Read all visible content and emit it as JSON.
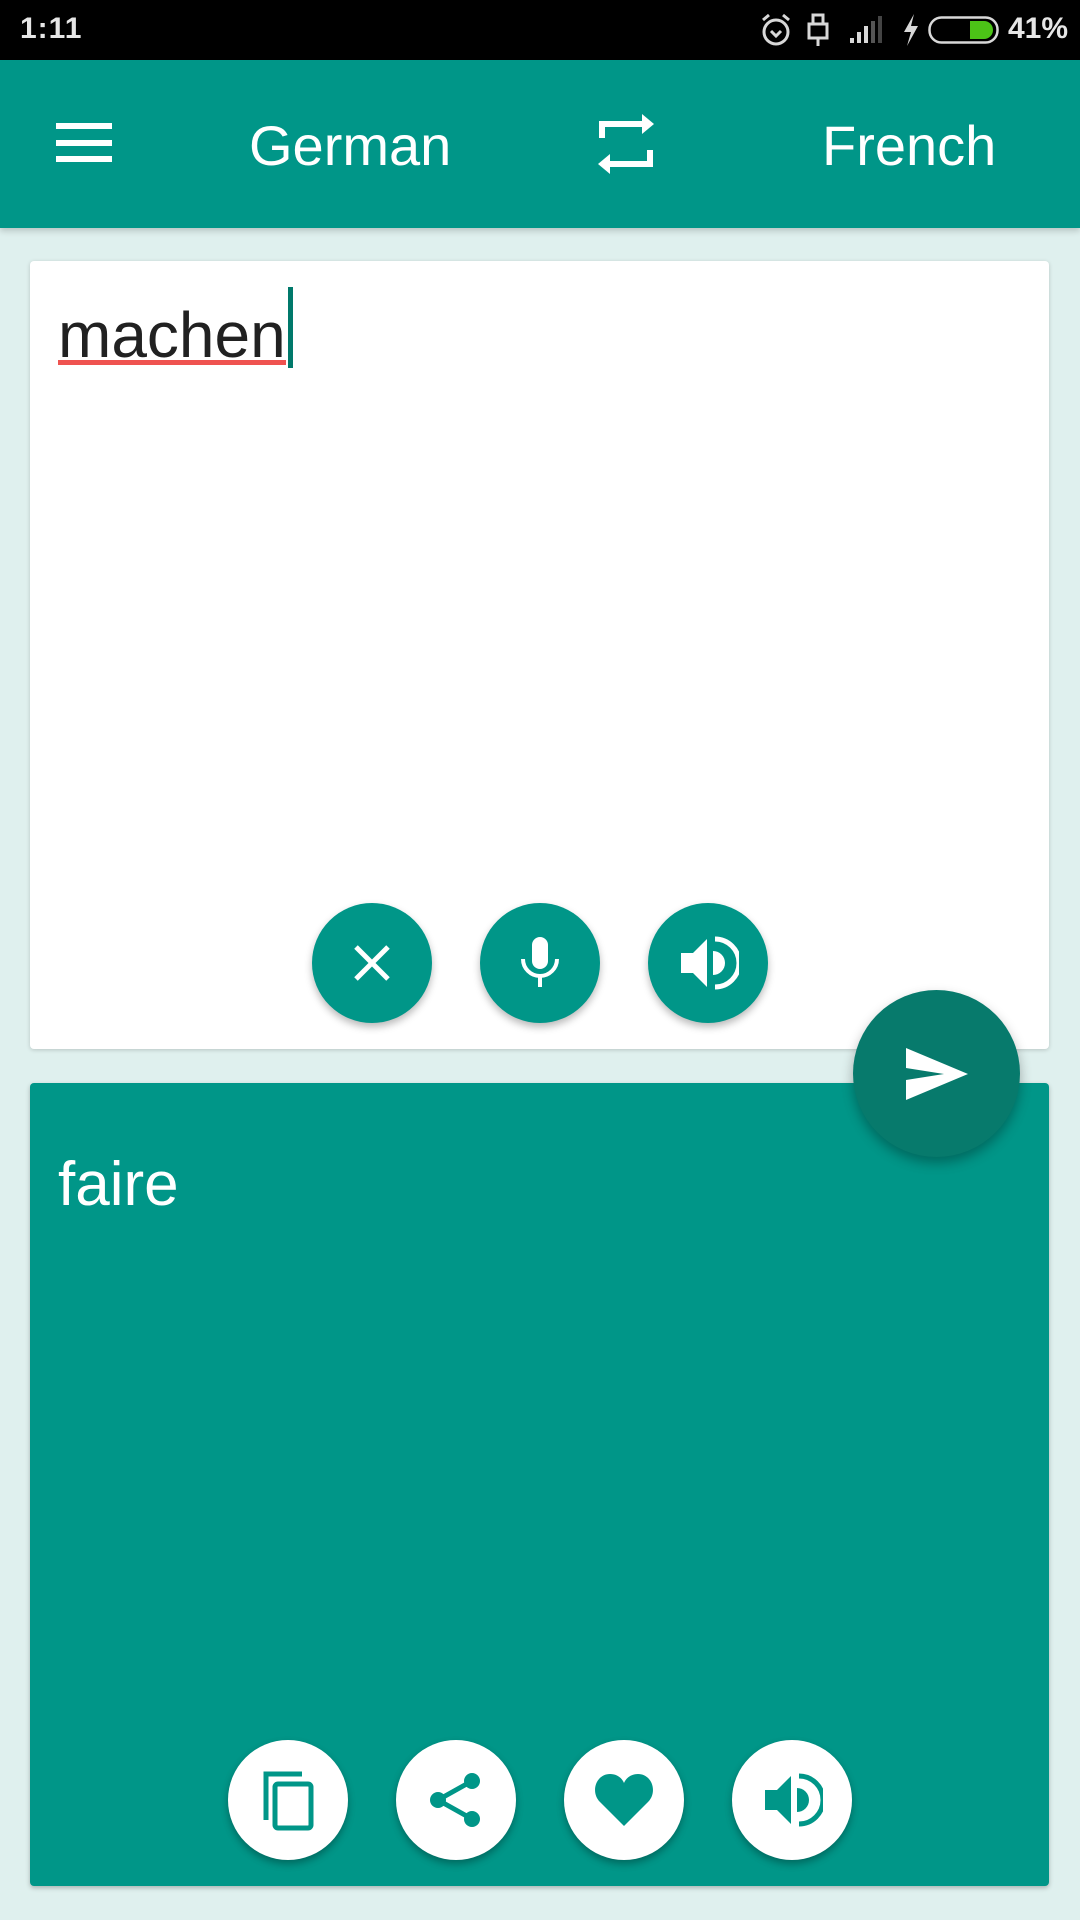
{
  "status_bar": {
    "time": "1:11",
    "battery_percent": "41%",
    "battery_level": 0.41,
    "icons": [
      "alarm-icon",
      "usb-icon",
      "signal-icon",
      "charging-icon",
      "battery-icon"
    ],
    "battery_color": "#4cc417"
  },
  "app_bar": {
    "menu_icon": "hamburger-menu-icon",
    "source_language": "German",
    "swap_icon": "swap-languages-icon",
    "target_language": "French",
    "background_color": "#009688"
  },
  "input": {
    "text": "machen",
    "actions": [
      {
        "name": "clear",
        "icon": "close-icon"
      },
      {
        "name": "voice-input",
        "icon": "microphone-icon"
      },
      {
        "name": "speak",
        "icon": "speaker-icon"
      }
    ]
  },
  "translate_button": {
    "icon": "send-icon",
    "color": "#077a6c"
  },
  "output": {
    "text": "faire",
    "actions": [
      {
        "name": "copy",
        "icon": "copy-icon"
      },
      {
        "name": "share",
        "icon": "share-icon"
      },
      {
        "name": "favorite",
        "icon": "heart-icon"
      },
      {
        "name": "speak",
        "icon": "speaker-icon"
      }
    ]
  },
  "colors": {
    "accent": "#009688",
    "background": "#dff0ee",
    "spellcheck_underline": "#ef5350"
  }
}
